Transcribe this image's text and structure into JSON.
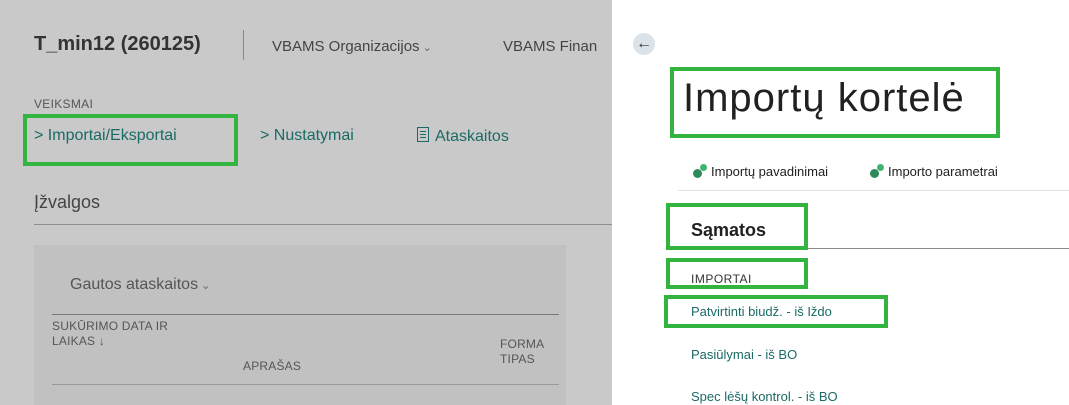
{
  "header": {
    "company": "T_min12 (260125)",
    "org_menu": "VBAMS Organizacijos",
    "fin_menu": "VBAMS Finan"
  },
  "actions": {
    "section_label": "VEIKSMAI",
    "import_export": "> Importai/Eksportai",
    "settings": "> Nustatymai",
    "reports": "Ataskaitos"
  },
  "insights": {
    "title": "Įžvalgos",
    "card_title": "Gautos ataskaitos",
    "columns": [
      "SUKŪRIMO DATA IR LAIKAS ↓",
      "APRAŠAS",
      "FORMA TIPAS"
    ]
  },
  "card": {
    "title": "Importų kortelė",
    "toolbar": [
      "Importų pavadinimai",
      "Importo parametrai"
    ],
    "section": "Sąmatos",
    "group": "IMPORTAI",
    "links": [
      "Patvirtinti biudž. - iš Iždo",
      "Pasiūlymai - iš BO",
      "Spec lėšų kontrol. - iš BO"
    ]
  },
  "colors": {
    "accent": "#1a6a66",
    "highlight": "#33b43f",
    "overlay": "#c9c9c9"
  },
  "icons": [
    "back-arrow-icon",
    "chevron-down-icon",
    "report-icon",
    "gear-icon"
  ]
}
